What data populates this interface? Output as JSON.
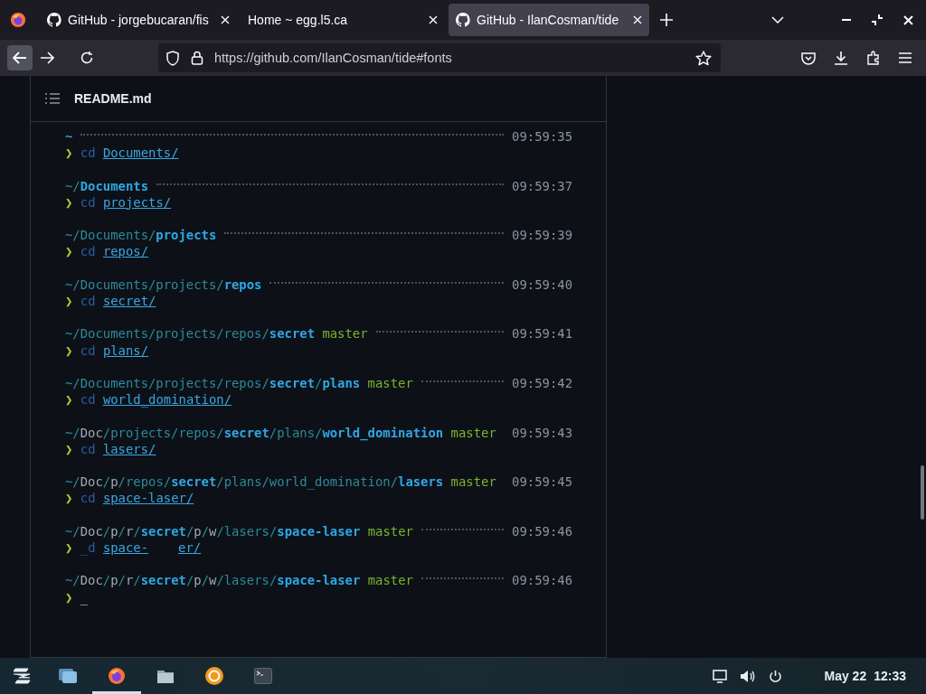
{
  "browser": {
    "tabs": [
      {
        "title": "GitHub - jorgebucaran/fis",
        "kind": "github",
        "selected": false
      },
      {
        "title": "Home ~ egg.l5.ca",
        "kind": "plain",
        "selected": false
      },
      {
        "title": "GitHub - IlanCosman/tide",
        "kind": "github",
        "selected": true
      }
    ],
    "url": "https://github.com/IlanCosman/tide#fonts"
  },
  "readme": {
    "title": "README.md",
    "terminal": [
      {
        "path": [
          {
            "text": "~",
            "kind": "tilde"
          }
        ],
        "dots": true,
        "time": "09:59:35",
        "prompt": "❯",
        "command": "cd",
        "args": [
          "Documents/"
        ]
      },
      {
        "path": [
          {
            "text": "~/",
            "kind": "dim"
          },
          {
            "text": "Documents",
            "kind": "bold"
          }
        ],
        "dots": true,
        "time": "09:59:37",
        "prompt": "❯",
        "command": "cd",
        "args": [
          "projects/"
        ]
      },
      {
        "path": [
          {
            "text": "~/Documents/",
            "kind": "dim"
          },
          {
            "text": "projects",
            "kind": "bold"
          }
        ],
        "dots": true,
        "time": "09:59:39",
        "prompt": "❯",
        "command": "cd",
        "args": [
          "repos/"
        ]
      },
      {
        "path": [
          {
            "text": "~/Documents/projects/",
            "kind": "dim"
          },
          {
            "text": "repos",
            "kind": "bold"
          }
        ],
        "dots": true,
        "time": "09:59:40",
        "prompt": "❯",
        "command": "cd",
        "args": [
          "secret/"
        ]
      },
      {
        "path": [
          {
            "text": "~/Documents/projects/repos/",
            "kind": "dim"
          },
          {
            "text": "secret",
            "kind": "bold"
          }
        ],
        "branch": "master",
        "dots": true,
        "time": "09:59:41",
        "prompt": "❯",
        "command": "cd",
        "args": [
          "plans/"
        ]
      },
      {
        "path": [
          {
            "text": "~/Documents/projects/repos/",
            "kind": "dim"
          },
          {
            "text": "secret",
            "kind": "bold"
          },
          {
            "text": "/",
            "kind": "dim"
          },
          {
            "text": "plans",
            "kind": "bold"
          }
        ],
        "branch": "master",
        "dots": true,
        "time": "09:59:42",
        "prompt": "❯",
        "command": "cd",
        "args": [
          "world_domination/"
        ]
      },
      {
        "path": [
          {
            "text": "~/",
            "kind": "dim"
          },
          {
            "text": "Doc",
            "kind": "light"
          },
          {
            "text": "/projects/repos/",
            "kind": "dim"
          },
          {
            "text": "secret",
            "kind": "bold"
          },
          {
            "text": "/plans/",
            "kind": "dim"
          },
          {
            "text": "world_domination",
            "kind": "bold"
          }
        ],
        "branch": "master",
        "dots": false,
        "time": "09:59:43",
        "prompt": "❯",
        "command": "cd",
        "args": [
          "lasers/"
        ]
      },
      {
        "path": [
          {
            "text": "~/",
            "kind": "dim"
          },
          {
            "text": "Doc",
            "kind": "light"
          },
          {
            "text": "/",
            "kind": "dim"
          },
          {
            "text": "p",
            "kind": "light"
          },
          {
            "text": "/repos/",
            "kind": "dim"
          },
          {
            "text": "secret",
            "kind": "bold"
          },
          {
            "text": "/plans/world_domination/",
            "kind": "dim"
          },
          {
            "text": "lasers",
            "kind": "bold"
          }
        ],
        "branch": "master",
        "dots": false,
        "time": "09:59:45",
        "prompt": "❯",
        "command": "cd",
        "args": [
          "space-laser/"
        ]
      },
      {
        "path": [
          {
            "text": "~/",
            "kind": "dim"
          },
          {
            "text": "Doc",
            "kind": "light"
          },
          {
            "text": "/",
            "kind": "dim"
          },
          {
            "text": "p",
            "kind": "light"
          },
          {
            "text": "/",
            "kind": "dim"
          },
          {
            "text": "r",
            "kind": "light"
          },
          {
            "text": "/",
            "kind": "dim"
          },
          {
            "text": "secret",
            "kind": "bold"
          },
          {
            "text": "/",
            "kind": "dim"
          },
          {
            "text": "p",
            "kind": "light"
          },
          {
            "text": "/",
            "kind": "dim"
          },
          {
            "text": "w",
            "kind": "light"
          },
          {
            "text": "/lasers/",
            "kind": "dim"
          },
          {
            "text": "space-laser",
            "kind": "bold"
          }
        ],
        "branch": "master",
        "dots": true,
        "time": "09:59:46",
        "prompt": "❯",
        "command": "_d",
        "args": [
          "space-",
          "er/"
        ]
      },
      {
        "path": [
          {
            "text": "~/",
            "kind": "dim"
          },
          {
            "text": "Doc",
            "kind": "light"
          },
          {
            "text": "/",
            "kind": "dim"
          },
          {
            "text": "p",
            "kind": "light"
          },
          {
            "text": "/",
            "kind": "dim"
          },
          {
            "text": "r",
            "kind": "light"
          },
          {
            "text": "/",
            "kind": "dim"
          },
          {
            "text": "secret",
            "kind": "bold"
          },
          {
            "text": "/",
            "kind": "dim"
          },
          {
            "text": "p",
            "kind": "light"
          },
          {
            "text": "/",
            "kind": "dim"
          },
          {
            "text": "w",
            "kind": "light"
          },
          {
            "text": "/lasers/",
            "kind": "dim"
          },
          {
            "text": "space-laser",
            "kind": "bold"
          }
        ],
        "branch": "master",
        "dots": true,
        "time": "09:59:46",
        "prompt": "❯",
        "cursor": "_"
      }
    ]
  },
  "taskbar": {
    "apps": [
      {
        "kind": "windows",
        "active": false
      },
      {
        "kind": "firefox",
        "active": true
      },
      {
        "kind": "files",
        "active": false
      },
      {
        "kind": "software",
        "active": false
      },
      {
        "kind": "terminal",
        "active": false
      }
    ],
    "date": "May 22",
    "time": "12:33"
  }
}
